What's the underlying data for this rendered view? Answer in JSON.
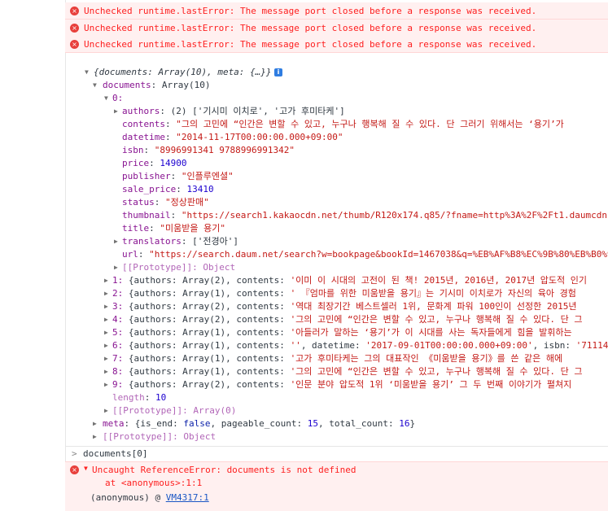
{
  "errors": [
    "Unchecked runtime.lastError: The message port closed before a response was received.",
    "Unchecked runtime.lastError: The message port closed before a response was received.",
    "Unchecked runtime.lastError: The message port closed before a response was received."
  ],
  "error_icon": "×",
  "summary": "{documents: Array(10), meta: {…}}",
  "info_badge": "i",
  "documents_label": "documents",
  "documents_type": "Array(10)",
  "item0_label": "0:",
  "item0": {
    "authors_key": "authors",
    "authors_val": "(2) ['기시미 이치로', '고가 후미타케']",
    "contents_key": "contents",
    "contents_val": "\"그의 고민에 “인간은 변할 수 있고, 누구나 행복해 질 수 있다. 단 그러기 위해서는 ‘용기’가",
    "datetime_key": "datetime",
    "datetime_val": "\"2014-11-17T00:00:00.000+09:00\"",
    "isbn_key": "isbn",
    "isbn_val": "\"8996991341 9788996991342\"",
    "price_key": "price",
    "price_val": "14900",
    "publisher_key": "publisher",
    "publisher_val": "\"인플루엔셜\"",
    "sale_price_key": "sale_price",
    "sale_price_val": "13410",
    "status_key": "status",
    "status_val": "\"정상판매\"",
    "thumbnail_key": "thumbnail",
    "thumbnail_val": "\"https://search1.kakaocdn.net/thumb/R120x174.q85/?fname=http%3A%2F%2Ft1.daumcdn.n",
    "title_key": "title",
    "title_val": "\"미움받을 용기\"",
    "translators_key": "translators",
    "translators_val": "['전경아']",
    "url_key": "url",
    "url_val": "\"https://search.daum.net/search?w=bookpage&bookId=1467038&q=%EB%AF%B8%EC%9B%80%EB%B0%9B%",
    "proto": "[[Prototype]]: Object"
  },
  "items": [
    {
      "idx": "1:",
      "pre": "{authors: Array(2), contents: ",
      "str": "'이미 이 시대의 고전이 된 책! 2015년, 2016년, 2017년 압도적 인기"
    },
    {
      "idx": "2:",
      "pre": "{authors: Array(1), contents: ",
      "str": "' 『엄마를 위한 미움받을 용기』는 기시미 이치로가 자신의 육아 경험"
    },
    {
      "idx": "3:",
      "pre": "{authors: Array(2), contents: ",
      "str": "'역대 최장기간 베스트셀러 1위, 문화계 파워 100인이 선정한 2015년"
    },
    {
      "idx": "4:",
      "pre": "{authors: Array(2), contents: ",
      "str": "'그의 고민에 “인간은 변할 수 있고, 누구나 행복해 질 수 있다. 단 그"
    },
    {
      "idx": "5:",
      "pre": "{authors: Array(1), contents: ",
      "str": "'아들러가 말하는 ‘용기’가 이 시대를 사는 독자들에게 힘을 발휘하는"
    },
    {
      "idx": "6:",
      "pre": "{authors: Array(1), contents: ",
      "str": "''",
      "post": ", datetime: ",
      "str2": "'2017-09-01T00:00:00.000+09:00'",
      "post2": ", isbn: ",
      "str3": "'711149"
    },
    {
      "idx": "7:",
      "pre": "{authors: Array(1), contents: ",
      "str": "'고가 후미타케는 그의 대표작인 《미움받을 용기》를 쓴 같은 해에"
    },
    {
      "idx": "8:",
      "pre": "{authors: Array(1), contents: ",
      "str": "'그의 고민에 “인간은 변할 수 있고, 누구나 행복해 질 수 있다. 단 그"
    },
    {
      "idx": "9:",
      "pre": "{authors: Array(2), contents: ",
      "str": "'인문 분야 압도적 1위 ‘미움받을 용기’ 그 두 번째 이야기가 펼쳐지"
    }
  ],
  "length_key": "length",
  "length_val": "10",
  "array_proto": "[[Prototype]]: Array(0)",
  "meta_key": "meta",
  "meta_pre": "{is_end: ",
  "meta_is_end": "false",
  "meta_mid1": ", pageable_count: ",
  "meta_pageable": "15",
  "meta_mid2": ", total_count: ",
  "meta_total": "16",
  "meta_end": "}",
  "object_proto": "[[Prototype]]: Object",
  "prompt_symbol": ">",
  "command": "documents[0]",
  "uncaught": {
    "message": "Uncaught ReferenceError: documents is not defined",
    "at_line": "at <anonymous>:1:1",
    "anon": "(anonymous) @ ",
    "link": "VM4317:1"
  },
  "colors": {
    "error_text": "#fe2020",
    "error_bg": "#fff0f0",
    "key": "#881391",
    "string": "#c41a16",
    "number": "#1c00cf"
  }
}
